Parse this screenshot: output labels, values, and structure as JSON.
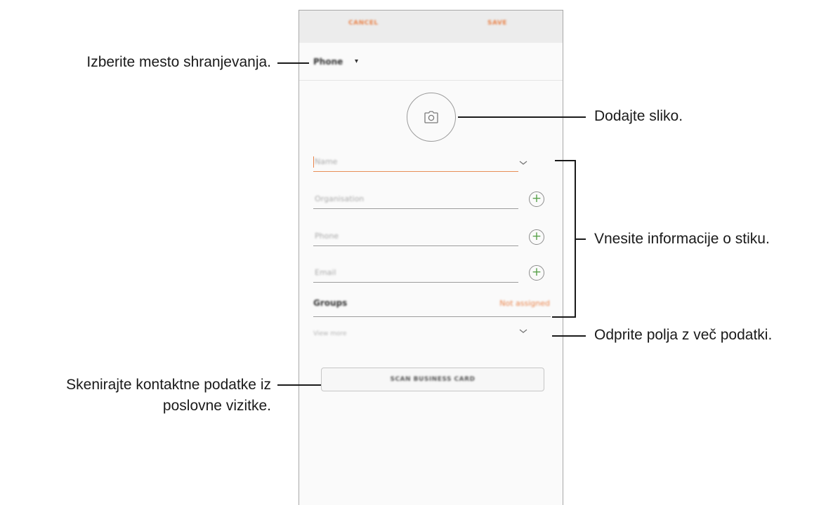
{
  "app_bar": {
    "cancel_label": "CANCEL",
    "save_label": "SAVE"
  },
  "storage": {
    "selected": "Phone",
    "caret": "▾"
  },
  "photo": {
    "icon": "camera-icon"
  },
  "fields": {
    "name_placeholder": "Name",
    "organization_placeholder": "Organisation",
    "phone_placeholder": "Phone",
    "email_placeholder": "Email"
  },
  "groups": {
    "label": "Groups",
    "value": "Not assigned"
  },
  "view_more": {
    "label": "View more"
  },
  "scan_button": {
    "label": "SCAN BUSINESS CARD"
  },
  "annotations": {
    "storage": "Izberite mesto shranjevanja.",
    "photo": "Dodajte sliko.",
    "contact_info": "Vnesite informacije o stiku.",
    "more_fields": "Odprite polja z več podatki.",
    "scan_line1": "Skenirajte kontaktne podatke iz",
    "scan_line2": "poslovne vizitke."
  },
  "colors": {
    "accent": "#e9834a",
    "plus_green": "#5aa24c",
    "app_bar": "#ececec"
  }
}
